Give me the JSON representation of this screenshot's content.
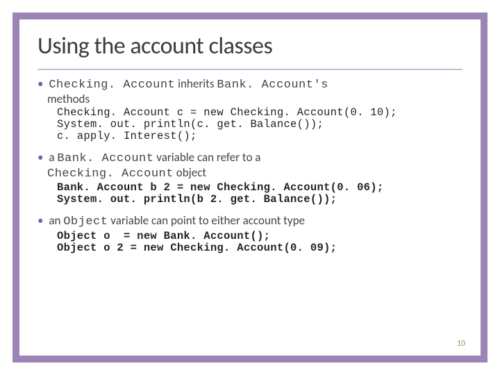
{
  "title": "Using the account classes",
  "bullets": [
    {
      "prefix": "Checking. Account",
      "mid": " inherits ",
      "suffix": "Bank. Account's",
      "tail": "methods"
    },
    {
      "line": "a Bank. Account variable can refer to a Checking. Account object",
      "prefix": "a ",
      "m1": "Bank. Account",
      "mid": " variable can refer to a ",
      "m2": "Checking. Account",
      "tail": " object"
    },
    {
      "prefix": "an ",
      "m1": "Object",
      "tail": " variable can point to either account type"
    }
  ],
  "code": [
    "Checking. Account c = new Checking. Account(0. 10);\nSystem. out. println(c. get. Balance());\nc. apply. Interest();",
    "Bank. Account b 2 = new Checking. Account(0. 06);\nSystem. out. println(b 2. get. Balance());",
    "Object o  = new Bank. Account();\nObject o 2 = new Checking. Account(0. 09);"
  ],
  "page_number": "10",
  "colors": {
    "border": "#9b85b5",
    "rule": "#c8bad7",
    "bullet_dot": "#7a6494"
  }
}
